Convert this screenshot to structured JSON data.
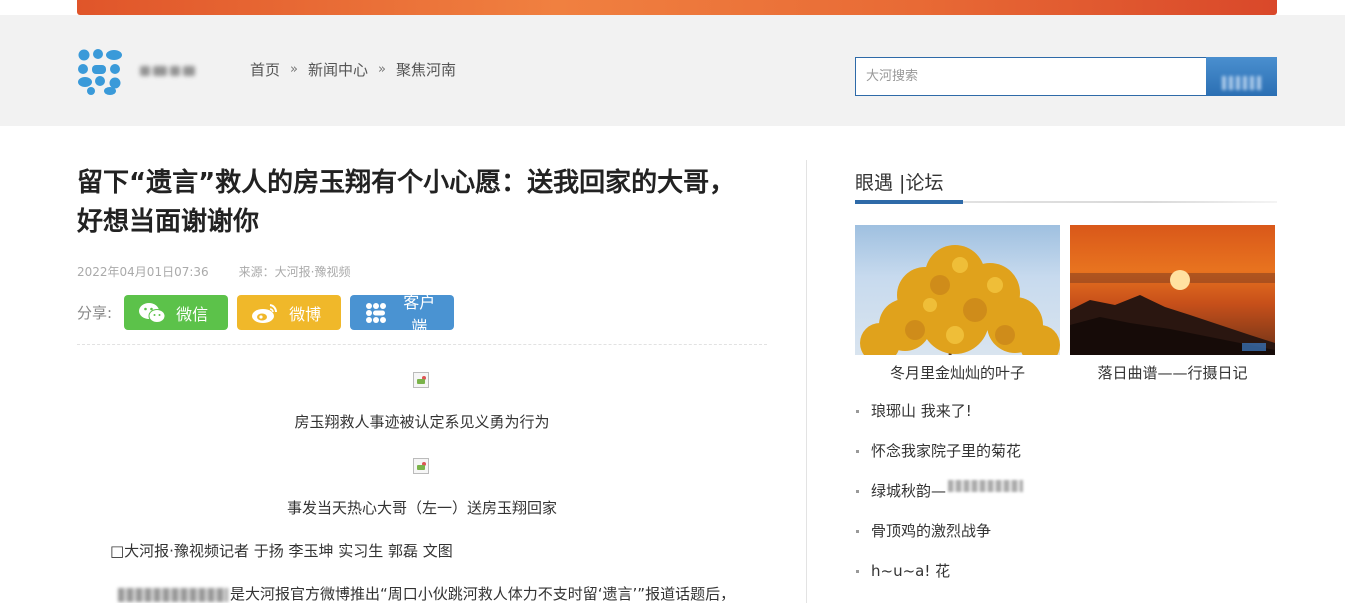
{
  "header": {
    "breadcrumb": [
      "首页",
      "新闻中心",
      "聚焦河南"
    ],
    "breadcrumb_separator": "»",
    "search_placeholder": "大河搜索"
  },
  "article": {
    "title": "留下“遗言”救人的房玉翔有个小心愿：送我回家的大哥，好想当面谢谢你",
    "date": "2022年04月01日07:36",
    "source": "来源：大河报·豫视频",
    "share_label": "分享:",
    "share_buttons": [
      "微信",
      "微博",
      "客户端"
    ],
    "caption1": "房玉翔救人事迹被认定系见义勇为行为",
    "caption2": "事发当天热心大哥（左一）送房玉翔回家",
    "byline": "□大河报·豫视频记者 于扬 李玉坤 实习生 郭磊 文图",
    "para1": "是大河报官方微博推出“周口小伙跳河救人体力不支时留‘遗言’”报道话题后，"
  },
  "sidebar": {
    "title": "眼遇 |论坛",
    "photos": [
      {
        "caption": "冬月里金灿灿的叶子"
      },
      {
        "caption": "落日曲谱——行摄日记"
      }
    ],
    "list": [
      "琅琊山 我来了!",
      "怀念我家院子里的菊花",
      "绿城秋韵—",
      "骨顶鸡的激烈战争",
      "h~u~a! 花"
    ]
  },
  "colors": {
    "accent": "#2e6aa8",
    "wechat": "#5cc24a",
    "weibo": "#f0b82a",
    "client": "#4a93d2"
  }
}
